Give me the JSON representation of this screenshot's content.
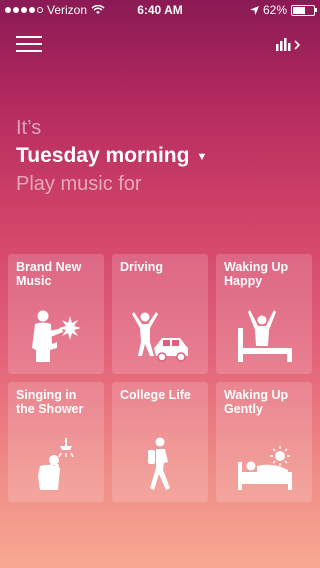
{
  "status_bar": {
    "carrier": "Verizon",
    "time": "6:40 AM",
    "battery": "62%",
    "battery_level": 0.62,
    "signal_bars": 4
  },
  "header": {
    "menu_icon": "hamburger-menu-icon",
    "stats_icon": "bar-chart-icon"
  },
  "intro": {
    "lead": "It’s",
    "day": "Tuesday morning",
    "caret": "⌄",
    "prompt": "Play music for"
  },
  "tiles": [
    {
      "label": "Brand New Music",
      "icon": "person-with-sparkle-icon"
    },
    {
      "label": "Driving",
      "icon": "person-with-car-icon"
    },
    {
      "label": "Waking Up Happy",
      "icon": "person-jumping-from-bed-icon"
    },
    {
      "label": "Singing in the Shower",
      "icon": "person-singing-in-shower-icon"
    },
    {
      "label": "College Life",
      "icon": "student-walking-icon"
    },
    {
      "label": "Waking Up Gently",
      "icon": "person-in-bed-with-sun-icon"
    }
  ]
}
